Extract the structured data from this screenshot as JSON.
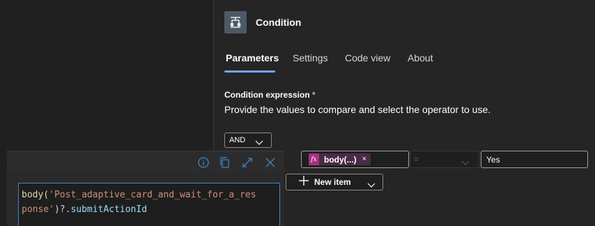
{
  "panel": {
    "title": "Condition",
    "tabs": [
      {
        "label": "Parameters",
        "active": true
      },
      {
        "label": "Settings",
        "active": false
      },
      {
        "label": "Code view",
        "active": false
      },
      {
        "label": "About",
        "active": false
      }
    ]
  },
  "condition": {
    "label": "Condition expression",
    "required_marker": "*",
    "description": "Provide the values to compare and select the operator to use.",
    "group_operator": "AND",
    "row": {
      "left_token": "body(...)",
      "token_close": "×",
      "operator": "=",
      "right_value": "Yes"
    },
    "new_item_label": "New item"
  },
  "expression_editor": {
    "line1_fn": "body(",
    "line1_str": "'Post_adaptive_card_and_wait_for_a_res",
    "line2_str": "ponse'",
    "line2_close": ")?.",
    "line2_prop": "submitActionId"
  },
  "colors": {
    "accent": "#6ea8ef",
    "token_bg": "#4a2a47",
    "token_fx": "#a6317f",
    "toolbar_icon": "#3b86c7"
  },
  "icons": [
    "condition-icon",
    "info-icon",
    "copy-icon",
    "expand-icon",
    "close-icon",
    "chevron-down-icon",
    "plus-icon",
    "fx-icon"
  ]
}
